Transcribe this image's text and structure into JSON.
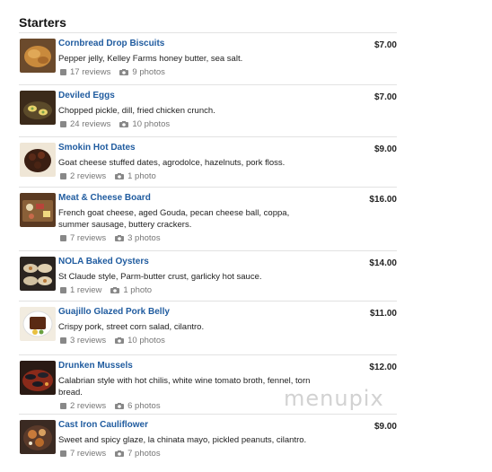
{
  "section_title": "Starters",
  "watermark": "menupix",
  "items": [
    {
      "name": "Cornbread Drop Biscuits",
      "desc": "Pepper jelly, Kelley Farms honey butter, sea salt.",
      "reviews": "17 reviews",
      "photos": "9 photos",
      "price": "$7.00"
    },
    {
      "name": "Deviled Eggs",
      "desc": "Chopped pickle, dill, fried chicken crunch.",
      "reviews": "24 reviews",
      "photos": "10 photos",
      "price": "$7.00"
    },
    {
      "name": "Smokin Hot Dates",
      "desc": "Goat cheese stuffed dates, agrodolce, hazelnuts, pork floss.",
      "reviews": "2 reviews",
      "photos": "1 photo",
      "price": "$9.00"
    },
    {
      "name": "Meat & Cheese Board",
      "desc": "French goat cheese, aged Gouda, pecan cheese ball, coppa, summer sausage, buttery crackers.",
      "reviews": "7 reviews",
      "photos": "3 photos",
      "price": "$16.00"
    },
    {
      "name": "NOLA Baked Oysters",
      "desc": "St Claude style, Parm-butter crust, garlicky hot sauce.",
      "reviews": "1 review",
      "photos": "1 photo",
      "price": "$14.00"
    },
    {
      "name": "Guajillo Glazed Pork Belly",
      "desc": "Crispy pork, street corn salad, cilantro.",
      "reviews": "3 reviews",
      "photos": "10 photos",
      "price": "$11.00"
    },
    {
      "name": "Drunken Mussels",
      "desc": "Calabrian style with hot chilis, white wine tomato broth, fennel, torn bread.",
      "reviews": "2 reviews",
      "photos": "6 photos",
      "price": "$12.00"
    },
    {
      "name": "Cast Iron Cauliflower",
      "desc": "Sweet and spicy glaze, la chinata mayo, pickled peanuts, cilantro.",
      "reviews": "7 reviews",
      "photos": "7 photos",
      "price": "$9.00"
    }
  ]
}
